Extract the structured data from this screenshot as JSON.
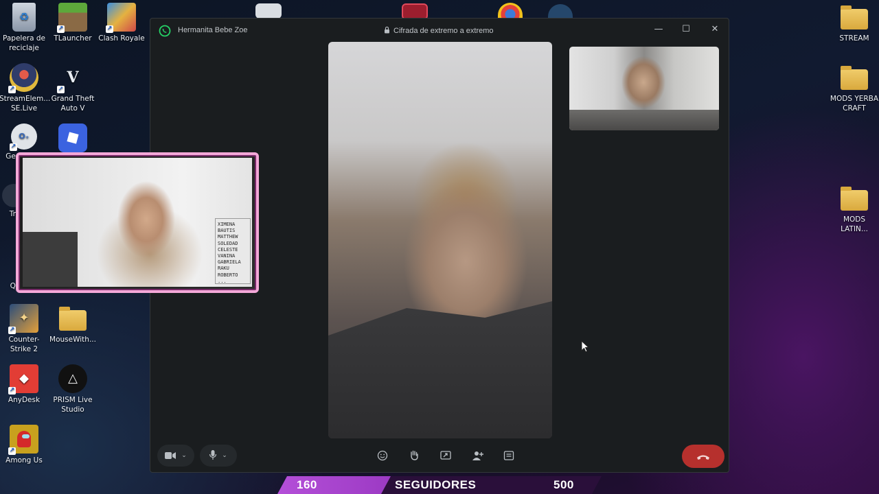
{
  "desktop": {
    "left_icons": [
      {
        "label": "Papelera de reciclaje",
        "icon": "recycle-bin-icon"
      },
      {
        "label": "TLauncher",
        "icon": "minecraft-block-icon"
      },
      {
        "label": "Clash Royale",
        "icon": "clash-royale-icon"
      },
      {
        "label": "StreamElem... SE.Live",
        "icon": "streamelements-icon"
      },
      {
        "label": "Grand Theft Auto V",
        "icon": "gta-v-icon"
      },
      {
        "label": "Ge... cor...",
        "icon": "app-icon"
      },
      {
        "label": "",
        "icon": "roblox-icon"
      },
      {
        "label": "Tran...",
        "icon": "app-icon"
      },
      {
        "label": "Qua...",
        "icon": "app-icon"
      },
      {
        "label": "Counter-Strike 2",
        "icon": "counter-strike-icon"
      },
      {
        "label": "MouseWith...",
        "icon": "folder-icon"
      },
      {
        "label": "AnyDesk",
        "icon": "anydesk-icon"
      },
      {
        "label": "PRISM Live Studio",
        "icon": "prism-live-icon"
      },
      {
        "label": "Among Us",
        "icon": "among-us-icon"
      }
    ],
    "right_icons": [
      {
        "label": "STREAM",
        "icon": "folder-icon"
      },
      {
        "label": "MODS YERBA CRAFT",
        "icon": "folder-icon"
      },
      {
        "label": "MODS LATIN...",
        "icon": "folder-icon"
      }
    ]
  },
  "call_window": {
    "contact_name": "Hermanita Bebe Zoe",
    "encryption_label": "Cifrada de extremo a extremo",
    "window_controls": [
      "minimize",
      "maximize",
      "close"
    ],
    "controls": [
      "camera",
      "microphone",
      "emoji",
      "raise-hand",
      "share-screen",
      "add-participant",
      "more-options",
      "end-call"
    ]
  },
  "webcam_board_lines": [
    "XIMENA",
    "BAUTIS",
    "MATTHEW",
    "SOLEDAD",
    "CELESTE",
    "VANINA",
    "GABRIELA",
    "RAKU",
    "ROBERTO",
    "..."
  ],
  "followers_bar": {
    "current": "160",
    "label": "SEGUIDORES",
    "goal": "500",
    "progress_fraction": 0.32
  },
  "colors": {
    "accent_pink": "#f4a8d8",
    "end_call_red": "#b6302d",
    "follow_bar_purple": "#b44fd8"
  }
}
